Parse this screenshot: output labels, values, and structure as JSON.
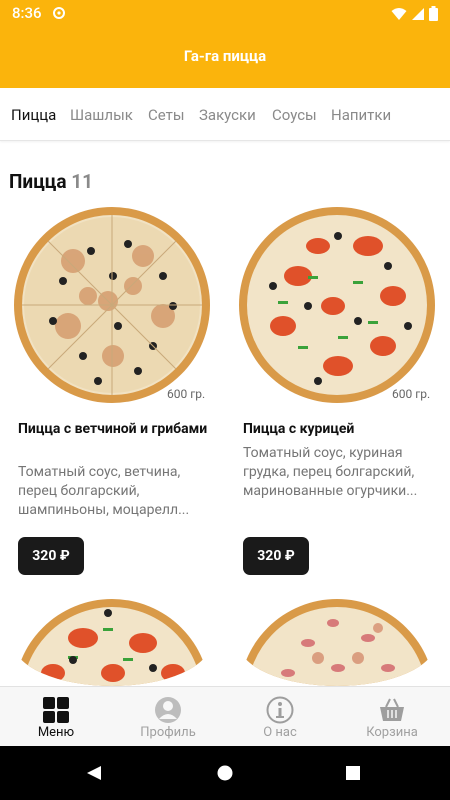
{
  "status_bar": {
    "time": "8:36"
  },
  "app": {
    "title": "Га-га пицца"
  },
  "tabs": [
    {
      "label": "Пицца",
      "active": true
    },
    {
      "label": "Шашлык",
      "active": false
    },
    {
      "label": "Сеты",
      "active": false
    },
    {
      "label": "Закуски",
      "active": false
    },
    {
      "label": "Соусы",
      "active": false
    },
    {
      "label": "Напитки",
      "active": false
    }
  ],
  "section": {
    "title": "Пицца",
    "count": "11"
  },
  "products": [
    {
      "weight": "600 гр.",
      "name": "Пицца с ветчиной и грибами",
      "description": "Томатный соус, ветчина, перец болгарский, шампиньоны, моцарелл...",
      "price": "320 ₽"
    },
    {
      "weight": "600 гр.",
      "name": "Пицца с курицей",
      "description": "Томатный соус, куриная грудка, перец болгарский, маринованные огурчики...",
      "price": "320 ₽"
    }
  ],
  "bottom_nav": [
    {
      "label": "Меню",
      "icon": "grid-icon",
      "active": true
    },
    {
      "label": "Профиль",
      "icon": "user-icon",
      "active": false
    },
    {
      "label": "О нас",
      "icon": "info-icon",
      "active": false
    },
    {
      "label": "Корзина",
      "icon": "basket-icon",
      "active": false
    }
  ],
  "colors": {
    "accent": "#fbb40c",
    "price_button": "#1a1a1a",
    "nav_active": "#111111",
    "nav_inactive": "#a0a0a0"
  }
}
